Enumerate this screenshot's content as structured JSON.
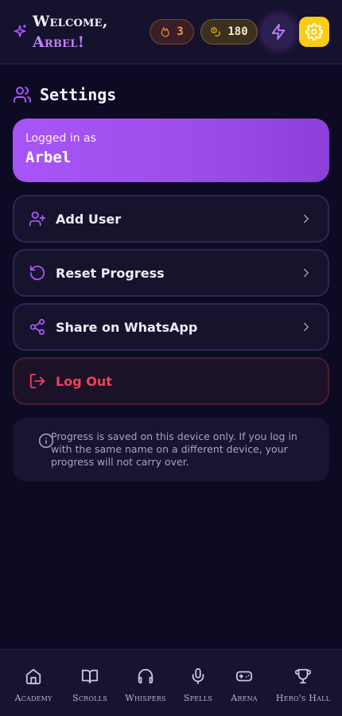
{
  "header": {
    "welcome_line1": "Welcome,",
    "welcome_line2": "Arbel!",
    "streak_count": "3",
    "coins_count": "180",
    "accent": "#c084fc",
    "gear_bg": "#facc15"
  },
  "settings": {
    "title": "Settings",
    "logged_in_label": "Logged in as",
    "user_name": "Arbel"
  },
  "actions": {
    "add_user": "Add User",
    "reset_progress": "Reset Progress",
    "share_whatsapp": "Share on WhatsApp",
    "log_out": "Log Out"
  },
  "info": {
    "text": "Progress is saved on this device only. If you log in with the same name on a different device, your progress will not carry over."
  },
  "nav": {
    "items": [
      {
        "label": "Academy",
        "icon": "home-icon"
      },
      {
        "label": "Scrolls",
        "icon": "book-icon"
      },
      {
        "label": "Whispers",
        "icon": "headphones-icon"
      },
      {
        "label": "Spells",
        "icon": "microphone-icon"
      },
      {
        "label": "Arena",
        "icon": "gamepad-icon"
      },
      {
        "label": "Hero's Hall",
        "icon": "trophy-icon"
      }
    ]
  },
  "colors": {
    "background": "#0d0b24",
    "purple": "#a855f7",
    "danger": "#f43f5e",
    "streak": "#fb923c",
    "gold": "#facc15"
  }
}
